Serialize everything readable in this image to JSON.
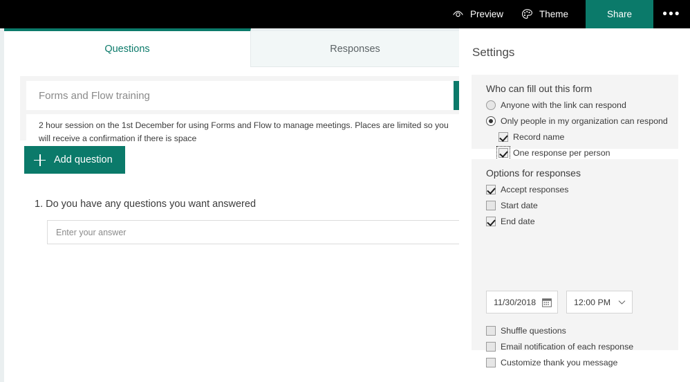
{
  "topbar": {
    "preview_label": "Preview",
    "preview_icon": "eye-icon",
    "theme_label": "Theme",
    "theme_icon": "palette-icon",
    "share_label": "Share",
    "more_label": "•••",
    "background_color": "#000000",
    "share_color": "#0b7a6a"
  },
  "tabs": [
    {
      "label": "Questions",
      "active": true
    },
    {
      "label": "Responses",
      "active": false
    }
  ],
  "form": {
    "title": "Forms and Flow training",
    "description": "2 hour session on the 1st December for using Forms and Flow to manage meetings.  Places are limited so you will receive a confirmation if there is space",
    "accent_color": "#0b7a6a",
    "add_question_label": "Add question",
    "add_question_icon": "plus-icon",
    "questions": [
      {
        "number": "1.",
        "text": "Do you have any questions you want answered",
        "full_text": "1. Do you have any questions you want answered",
        "answer_placeholder": "Enter your answer"
      }
    ]
  },
  "settings": {
    "title": "Settings",
    "who_section": {
      "heading": "Who can fill out this form",
      "options": [
        {
          "label": "Anyone with the link can respond",
          "selected": false
        },
        {
          "label": "Only people in my organization can respond",
          "selected": true
        }
      ],
      "sub_options": [
        {
          "label": "Record name",
          "checked": true,
          "focused": false
        },
        {
          "label": "One response per person",
          "checked": true,
          "focused": true
        }
      ]
    },
    "options_section": {
      "heading": "Options for responses",
      "checkboxes_top": [
        {
          "label": "Accept responses",
          "checked": true
        },
        {
          "label": "Start date",
          "checked": false
        },
        {
          "label": "End date",
          "checked": true
        }
      ],
      "end_date_value": "11/30/2018",
      "end_date_icon": "calendar-icon",
      "end_time_value": "12:00 PM",
      "end_time_icon": "chevron-down-icon",
      "checkboxes_bottom": [
        {
          "label": "Shuffle questions",
          "checked": false
        },
        {
          "label": "Email notification of each response",
          "checked": false
        },
        {
          "label": "Customize thank you message",
          "checked": false
        }
      ]
    }
  }
}
